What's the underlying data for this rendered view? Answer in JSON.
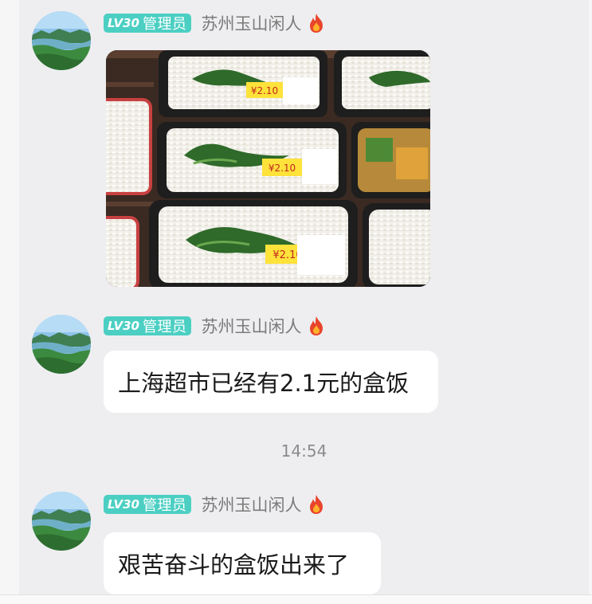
{
  "messages": [
    {
      "level": "LV30",
      "role": "管理员",
      "name": "苏州玉山闲人",
      "type": "image",
      "image_description": "三份透明塑料盒装的白米饭配绿叶菜，标价2.10",
      "price_labels": [
        "¥2.10",
        "¥2.10",
        "¥2.10"
      ]
    },
    {
      "level": "LV30",
      "role": "管理员",
      "name": "苏州玉山闲人",
      "type": "text",
      "text": "上海超市已经有2.1元的盒饭"
    },
    {
      "level": "LV30",
      "role": "管理员",
      "name": "苏州玉山闲人",
      "type": "text",
      "text": "艰苦奋斗的盒饭出来了"
    }
  ],
  "timestamp": "14:54",
  "icons": {
    "avatar": "lake-landscape-avatar",
    "badge_suffix": "fire-icon"
  },
  "colors": {
    "panel_bg": "#eeeef0",
    "bubble_bg": "#ffffff",
    "badge_bg": "#4ccfc3",
    "name_text": "#7a7a7a",
    "time_text": "#8b8b8b"
  }
}
